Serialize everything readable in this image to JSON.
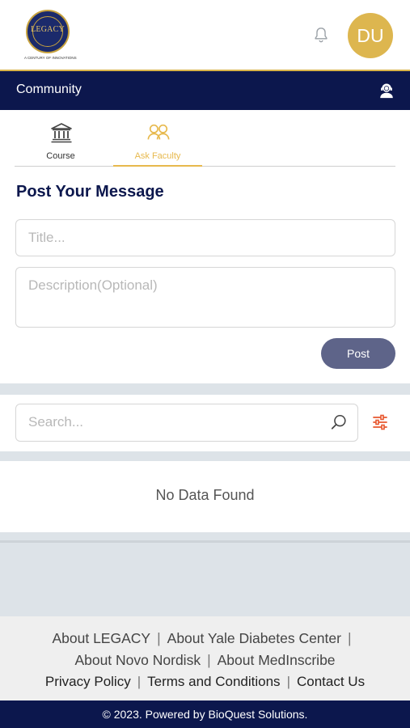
{
  "header": {
    "logo_text": "LEGACY",
    "logo_tagline": "A CENTURY OF INNOVATIONS",
    "avatar_initials": "DU",
    "avatar_color": "#ddb64f"
  },
  "navbar": {
    "title": "Community",
    "support_icon": "support-agent-icon"
  },
  "tabs": [
    {
      "label": "Course",
      "icon": "institution-icon",
      "active": false
    },
    {
      "label": "Ask Faculty",
      "icon": "people-icon",
      "active": true
    }
  ],
  "post": {
    "heading": "Post Your Message",
    "title_placeholder": "Title...",
    "description_placeholder": "Description(Optional)",
    "post_button": "Post"
  },
  "search": {
    "placeholder": "Search..."
  },
  "results": {
    "empty_message": "No Data Found"
  },
  "footer": {
    "links_row1": [
      "About LEGACY",
      "About Yale Diabetes Center"
    ],
    "links_row2": [
      "About Novo Nordisk",
      "About MedInscribe"
    ],
    "links_row3": [
      "Privacy Policy",
      "Terms and Conditions",
      "Contact Us"
    ],
    "copyright": "© 2023. Powered by BioQuest Solutions."
  },
  "colors": {
    "navy": "#0c174d",
    "gold": "#e7b94d",
    "button": "#5e6489"
  }
}
